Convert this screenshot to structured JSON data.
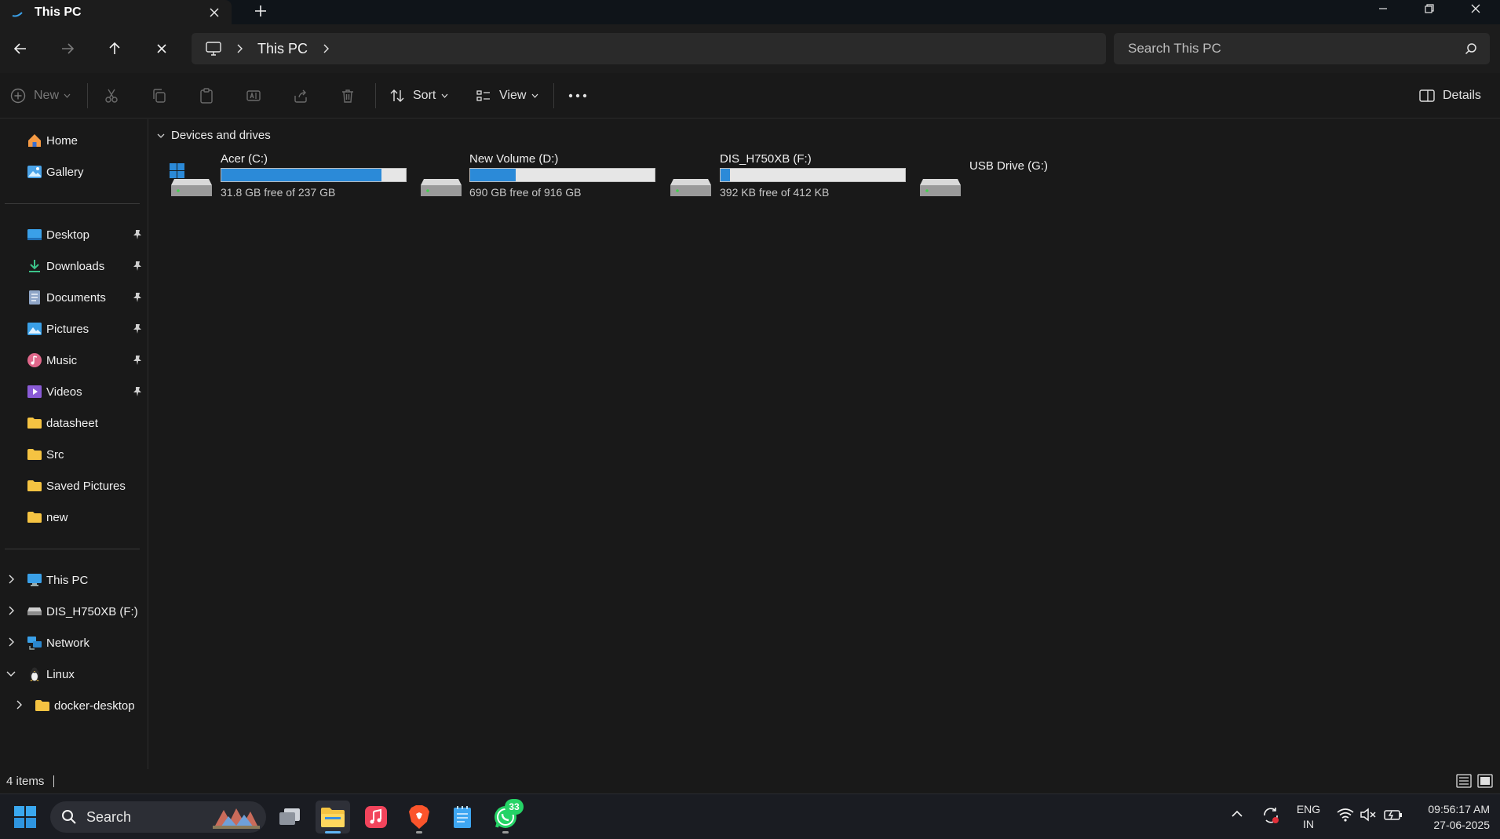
{
  "window": {
    "tab_title": "This PC",
    "new_tab_label": "+"
  },
  "address": {
    "crumb": "This PC",
    "search_placeholder": "Search This PC"
  },
  "commands": {
    "new_label": "New",
    "sort_label": "Sort",
    "view_label": "View",
    "details_label": "Details"
  },
  "sidebar": {
    "home": "Home",
    "gallery": "Gallery",
    "quick": [
      {
        "label": "Desktop",
        "icon": "desktop-icon"
      },
      {
        "label": "Downloads",
        "icon": "downloads-icon"
      },
      {
        "label": "Documents",
        "icon": "documents-icon"
      },
      {
        "label": "Pictures",
        "icon": "pictures-icon"
      },
      {
        "label": "Music",
        "icon": "music-icon"
      },
      {
        "label": "Videos",
        "icon": "videos-icon"
      },
      {
        "label": "datasheet",
        "icon": "folder-icon"
      },
      {
        "label": "Src",
        "icon": "folder-icon"
      },
      {
        "label": "Saved Pictures",
        "icon": "folder-icon"
      },
      {
        "label": "new",
        "icon": "folder-icon"
      }
    ],
    "tree": [
      {
        "label": "This PC",
        "icon": "computer-icon"
      },
      {
        "label": "DIS_H750XB (F:)",
        "icon": "drive-icon"
      },
      {
        "label": "Network",
        "icon": "network-icon"
      },
      {
        "label": "Linux",
        "icon": "linux-icon"
      },
      {
        "label": "docker-desktop",
        "icon": "folder-icon"
      }
    ]
  },
  "main": {
    "group_header": "Devices and drives",
    "drives": [
      {
        "name": "Acer (C:)",
        "free": "31.8 GB free of 237 GB",
        "used_fraction": 0.866
      },
      {
        "name": "New Volume (D:)",
        "free": "690 GB free of 916 GB",
        "used_fraction": 0.247
      },
      {
        "name": "DIS_H750XB (F:)",
        "free": "392 KB free of 412 KB",
        "used_fraction": 0.049
      },
      {
        "name": "USB Drive (G:)",
        "free": ""
      }
    ]
  },
  "status": {
    "items_count": "4 items"
  },
  "taskbar": {
    "search_label": "Search",
    "whatsapp_badge": "33",
    "lang_top": "ENG",
    "lang_bottom": "IN",
    "time": "09:56:17 AM",
    "date": "27-06-2025"
  },
  "colors": {
    "accent": "#2b8ad8",
    "background": "#191919",
    "folder": "#f5c342"
  }
}
